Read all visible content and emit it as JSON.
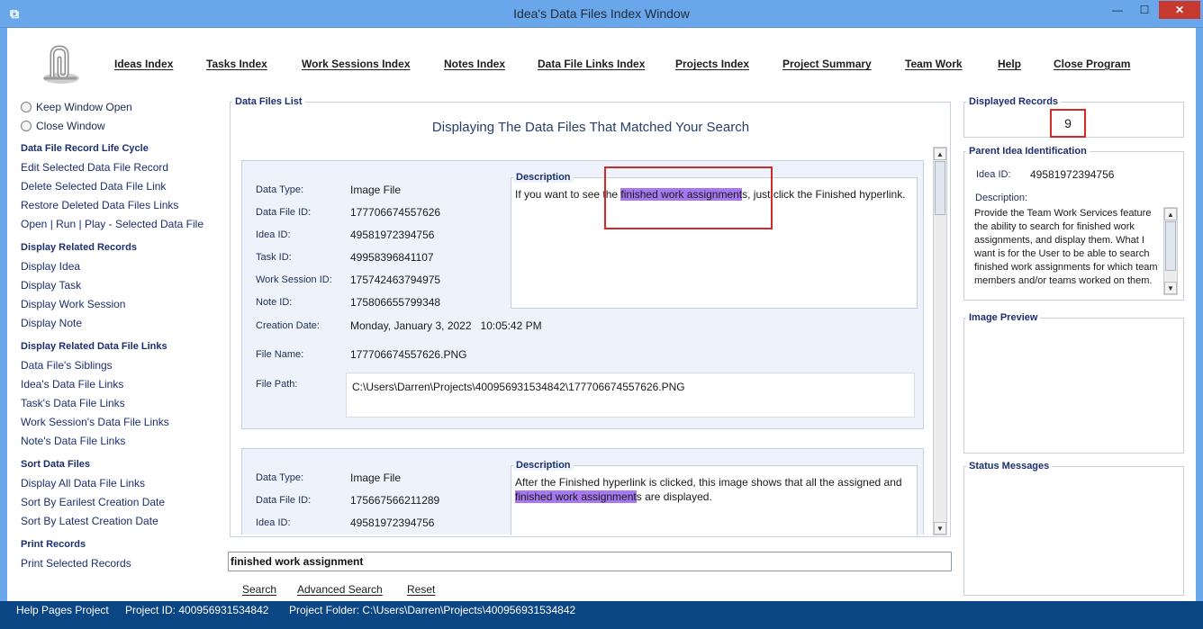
{
  "window": {
    "title": "Idea's Data Files Index Window"
  },
  "nav": [
    {
      "label": "Ideas Index"
    },
    {
      "label": "Tasks Index"
    },
    {
      "label": "Work Sessions Index"
    },
    {
      "label": "Notes Index"
    },
    {
      "label": "Data File Links Index"
    },
    {
      "label": "Projects Index"
    },
    {
      "label": "Project Summary"
    },
    {
      "label": "Team Work"
    },
    {
      "label": "Help"
    },
    {
      "label": "Close Program"
    }
  ],
  "sidebar": {
    "radios": [
      {
        "label": "Keep Window Open",
        "selected": false
      },
      {
        "label": "Close Window",
        "selected": false
      }
    ],
    "sections": [
      {
        "title": "Data File Record Life Cycle",
        "links": [
          "Edit Selected Data File Record",
          "Delete Selected Data File Link",
          "Restore Deleted Data Files Links",
          "Open | Run | Play - Selected Data File"
        ]
      },
      {
        "title": "Display Related Records",
        "links": [
          "Display Idea",
          "Display Task",
          "Display Work Session",
          "Display Note"
        ]
      },
      {
        "title": "Display Related Data File Links",
        "links": [
          "Data File's Siblings",
          "Idea's Data File Links",
          "Task's Data File Links",
          "Work Session's Data File Links",
          "Note's Data File Links"
        ]
      },
      {
        "title": "Sort Data Files",
        "links": [
          "Display All Data File Links",
          "Sort By Earilest Creation Date",
          "Sort By Latest Creation Date"
        ]
      },
      {
        "title": "Print Records",
        "links": [
          "Print Selected Records"
        ]
      }
    ]
  },
  "main": {
    "group_title": "Data Files List",
    "heading": "Displaying The Data Files That Matched Your Search",
    "labels": {
      "data_type": "Data Type:",
      "data_file_id": "Data File ID:",
      "idea_id": "Idea ID:",
      "task_id": "Task ID:",
      "work_session_id": "Work Session ID:",
      "note_id": "Note ID:",
      "creation_date": "Creation Date:",
      "file_name": "File Name:",
      "file_path": "File Path:",
      "description": "Description"
    },
    "records": [
      {
        "data_type": "Image File",
        "data_file_id": "177706674557626",
        "idea_id": "49581972394756",
        "task_id": "49958396841107",
        "work_session_id": "175742463794975",
        "note_id": "175806655799348",
        "creation_date": "Monday, January 3, 2022   10:05:42 PM",
        "file_name": "177706674557626.PNG",
        "file_path": "C:\\Users\\Darren\\Projects\\400956931534842\\177706674557626.PNG",
        "desc_before": "If you want to see the ",
        "desc_highlight": "finished work assignment",
        "desc_after": "s, just click the Finished hyperlink."
      },
      {
        "data_type": "Image File",
        "data_file_id": "175667566211289",
        "idea_id": "49581972394756",
        "desc_before": "After the Finished hyperlink is clicked, this image shows that all the assigned and ",
        "desc_highlight": "finished work assignment",
        "desc_after": "s are displayed."
      }
    ]
  },
  "search": {
    "value": "finished work assignment",
    "actions": [
      "Search",
      "Advanced Search",
      "Reset"
    ]
  },
  "right": {
    "displayed_title": "Displayed Records",
    "displayed_count": "9",
    "parent_title": "Parent Idea Identification",
    "idea_id_label": "Idea ID:",
    "idea_id_value": "49581972394756",
    "description_label": "Description:",
    "description_text": "Provide the Team Work Services feature the ability to search for finished work assignments, and display them. What I want is for the User to be able to search finished work assignments for which team members and/or teams worked on them.",
    "image_preview_title": "Image Preview",
    "status_title": "Status Messages"
  },
  "statusbar": {
    "project": "Help Pages Project",
    "project_id": "Project ID:  400956931534842",
    "project_folder": "Project Folder: C:\\Users\\Darren\\Projects\\400956931534842"
  }
}
